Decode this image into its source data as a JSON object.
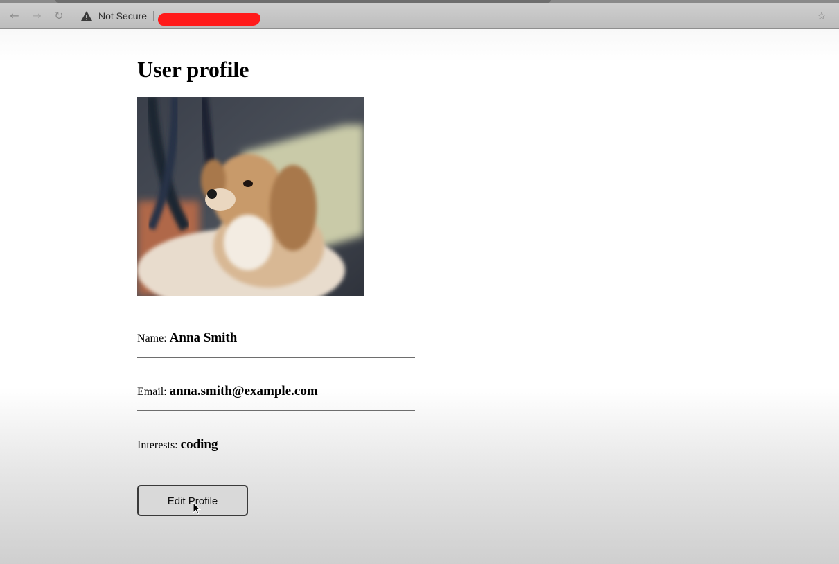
{
  "browser": {
    "security_label": "Not Secure",
    "icons": {
      "back": "back-arrow-icon",
      "forward": "forward-arrow-icon",
      "reload": "reload-icon",
      "warning": "warning-triangle-icon",
      "bookmark": "star-icon"
    },
    "url_redaction_color": "#ff1a1a"
  },
  "page": {
    "title": "User profile",
    "photo_subject": "dog",
    "fields": [
      {
        "label": "Name:",
        "value": "Anna Smith"
      },
      {
        "label": "Email:",
        "value": "anna.smith@example.com"
      },
      {
        "label": "Interests:",
        "value": "coding"
      }
    ],
    "edit_button_label": "Edit Profile"
  }
}
